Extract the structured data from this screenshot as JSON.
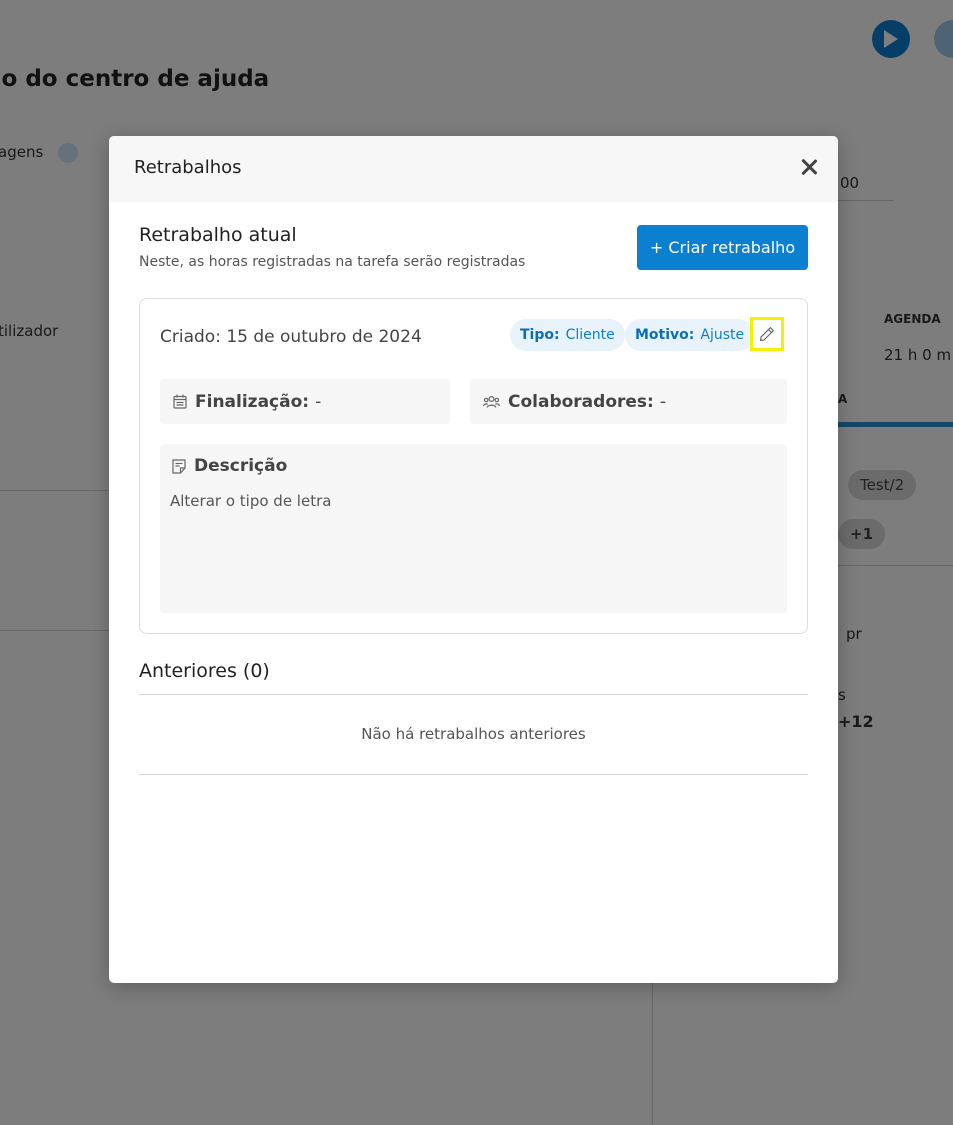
{
  "background": {
    "page_title": "ão do centro de ajuda",
    "texts": [
      "agens",
      "tilizador",
      "AGENDA",
      "21 h 0 m",
      "A",
      "Test/2",
      "+1",
      "+12",
      "s",
      "pr",
      "00"
    ]
  },
  "modal": {
    "title": "Retrabalhos",
    "current": {
      "title": "Retrabalho atual",
      "subtitle": "Neste, as horas registradas na tarefa serão registradas",
      "create_button": "+ Criar retrabalho"
    },
    "card": {
      "created": "Criado: 15 de outubro de 2024",
      "tipo_label": "Tipo:",
      "tipo_value": "Cliente",
      "motivo_label": "Motivo:",
      "motivo_value": "Ajuste",
      "finalizacao_label": "Finalização:",
      "finalizacao_value": "-",
      "colaboradores_label": "Colaboradores:",
      "colaboradores_value": "-",
      "descricao_label": "Descrição",
      "descricao_text": "Alterar o tipo de letra"
    },
    "previous": {
      "title": "Anteriores (0)",
      "empty": "Não há retrabalhos anteriores"
    }
  },
  "colors": {
    "primary": "#0b7fd0",
    "tag_bg": "#e8f2fa",
    "highlight": "#f5ef00",
    "overlay": "rgba(0,0,0,0.5)"
  }
}
